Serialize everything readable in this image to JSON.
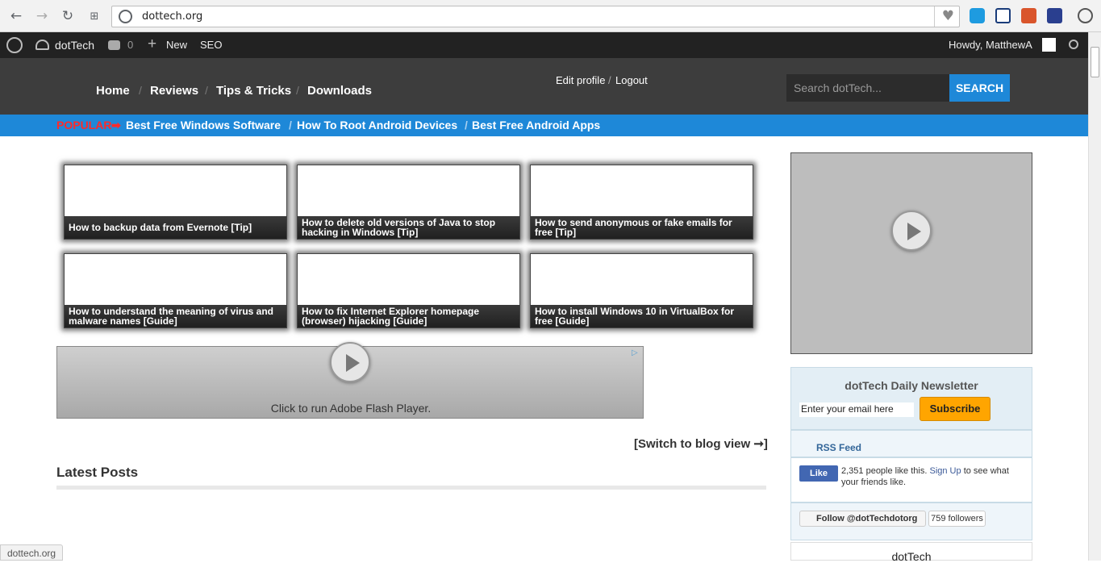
{
  "browser": {
    "url": "dottech.org",
    "status_url": "dottech.org"
  },
  "adminbar": {
    "comments_count": "0",
    "site_name": "dotTech",
    "new_label": "New",
    "seo_label": "SEO",
    "howdy": "Howdy, MatthewA"
  },
  "header": {
    "nav": [
      "Home",
      "Reviews",
      "Tips & Tricks",
      "Downloads"
    ],
    "edit_profile": "Edit profile",
    "slash": "/",
    "logout": "Logout",
    "search_placeholder": "Search dotTech...",
    "search_button": "SEARCH"
  },
  "popular": {
    "label": "POPULAR",
    "arrow": "➡",
    "links": [
      "Best Free Windows Software",
      "How To Root Android Devices",
      "Best Free Android Apps"
    ]
  },
  "thumbnails": [
    "How to backup data from Evernote [Tip]",
    "How to delete old versions of Java to stop hacking in Windows [Tip]",
    "How to send anonymous or fake emails for free [Tip]",
    "How to understand the meaning of virus and malware names [Guide]",
    "How to fix Internet Explorer homepage (browser) hijacking [Guide]",
    "How to install Windows 10 in VirtualBox for free [Guide]"
  ],
  "flash": {
    "text": "Click to run Adobe Flash Player."
  },
  "switch_view": "[Switch to blog view ➞]",
  "latest_posts": "Latest Posts",
  "sidebar": {
    "newsletter_title": "dotTech Daily Newsletter",
    "email_placeholder": "Enter your email here",
    "subscribe": "Subscribe",
    "rss": "RSS Feed",
    "fb_like": "Like",
    "fb_text_before": "2,351 people like this.",
    "fb_signup": "Sign Up",
    "fb_text_after": "to see what your friends like.",
    "twitter_follow": "Follow @dotTechdotorg",
    "twitter_followers": "759 followers",
    "footer_title": "dotTech"
  },
  "colors": {
    "accent_blue": "#1e88d8",
    "popular_red": "#ff2a2a",
    "subscribe_orange": "#ffa500"
  }
}
